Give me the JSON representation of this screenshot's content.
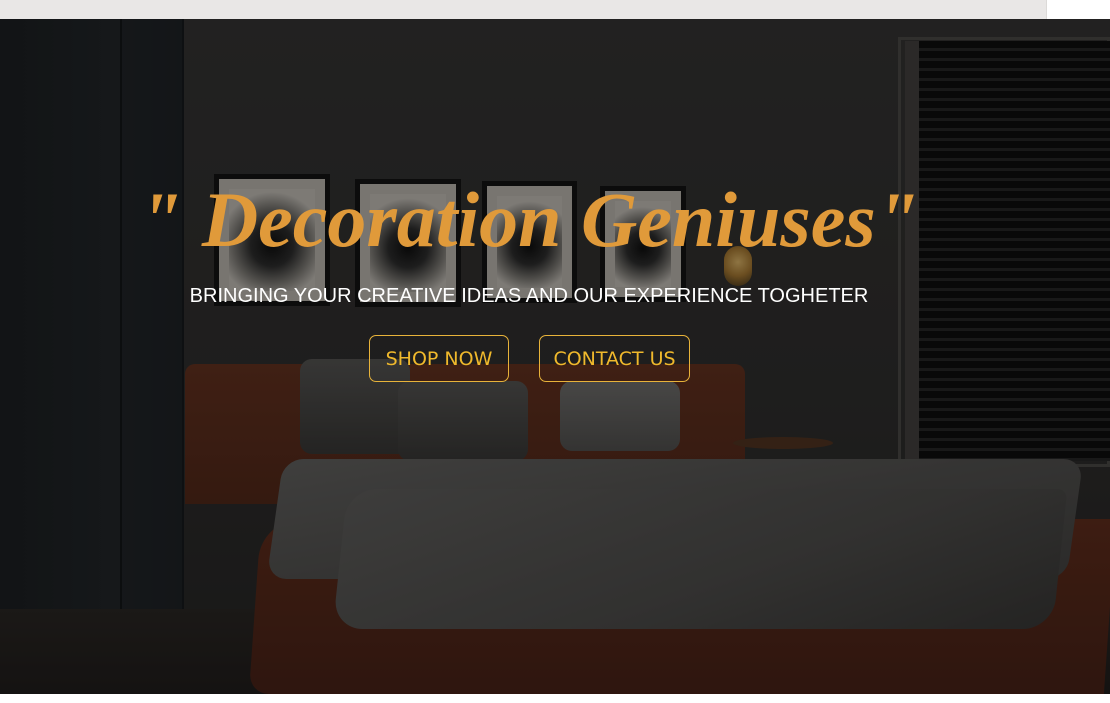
{
  "hero": {
    "headline": "\" Decoration Geniuses\"",
    "subheadline": "BRINGING YOUR CREATIVE IDEAS AND OUR EXPERIENCE TOGHETER",
    "buttons": {
      "shop_label": "SHOP NOW",
      "contact_label": "CONTACT US"
    },
    "background_image": "dark-bedroom-interior-photo"
  },
  "colors": {
    "headline": "#e09a3a",
    "button_text": "#f0b92c",
    "button_border": "#e8b33a",
    "subheadline": "#ffffff",
    "topbar": "#e9e7e6"
  }
}
